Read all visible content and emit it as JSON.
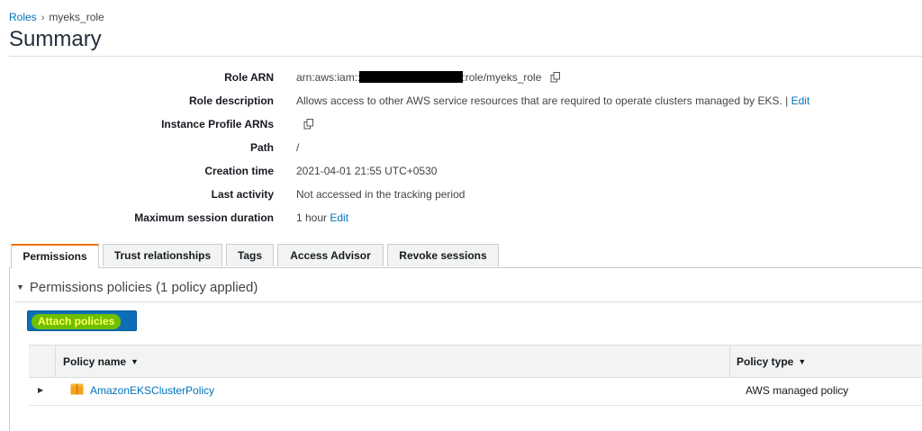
{
  "breadcrumb": {
    "parent": "Roles",
    "sep": "›",
    "current": "myeks_role"
  },
  "page_title": "Summary",
  "summary": {
    "role_arn": {
      "label": "Role ARN",
      "prefix": "arn:aws:iam::",
      "suffix": ":role/myeks_role"
    },
    "role_description": {
      "label": "Role description",
      "value": "Allows access to other AWS service resources that are required to operate clusters managed by EKS. |",
      "edit": "Edit"
    },
    "instance_profile": {
      "label": "Instance Profile ARNs"
    },
    "path": {
      "label": "Path",
      "value": "/"
    },
    "creation_time": {
      "label": "Creation time",
      "value": "2021-04-01 21:55 UTC+0530"
    },
    "last_activity": {
      "label": "Last activity",
      "value": "Not accessed in the tracking period"
    },
    "max_session": {
      "label": "Maximum session duration",
      "value": "1 hour",
      "edit": "Edit"
    }
  },
  "tabs": [
    "Permissions",
    "Trust relationships",
    "Tags",
    "Access Advisor",
    "Revoke sessions"
  ],
  "permissions": {
    "section_title": "Permissions policies (1 policy applied)",
    "attach_label": "Attach policies",
    "columns": {
      "name": "Policy name",
      "type": "Policy type"
    },
    "rows": [
      {
        "name": "AmazonEKSClusterPolicy",
        "type": "AWS managed policy"
      }
    ]
  },
  "colors": {
    "accent": "#ec7211",
    "link": "#0073bb",
    "button": "#0d6eb8",
    "highlight": "#6fbf00"
  },
  "icons": [
    "copy-icon",
    "chevron-right-icon",
    "caret-down-icon",
    "expand-triangle-icon",
    "policy-box-icon"
  ]
}
